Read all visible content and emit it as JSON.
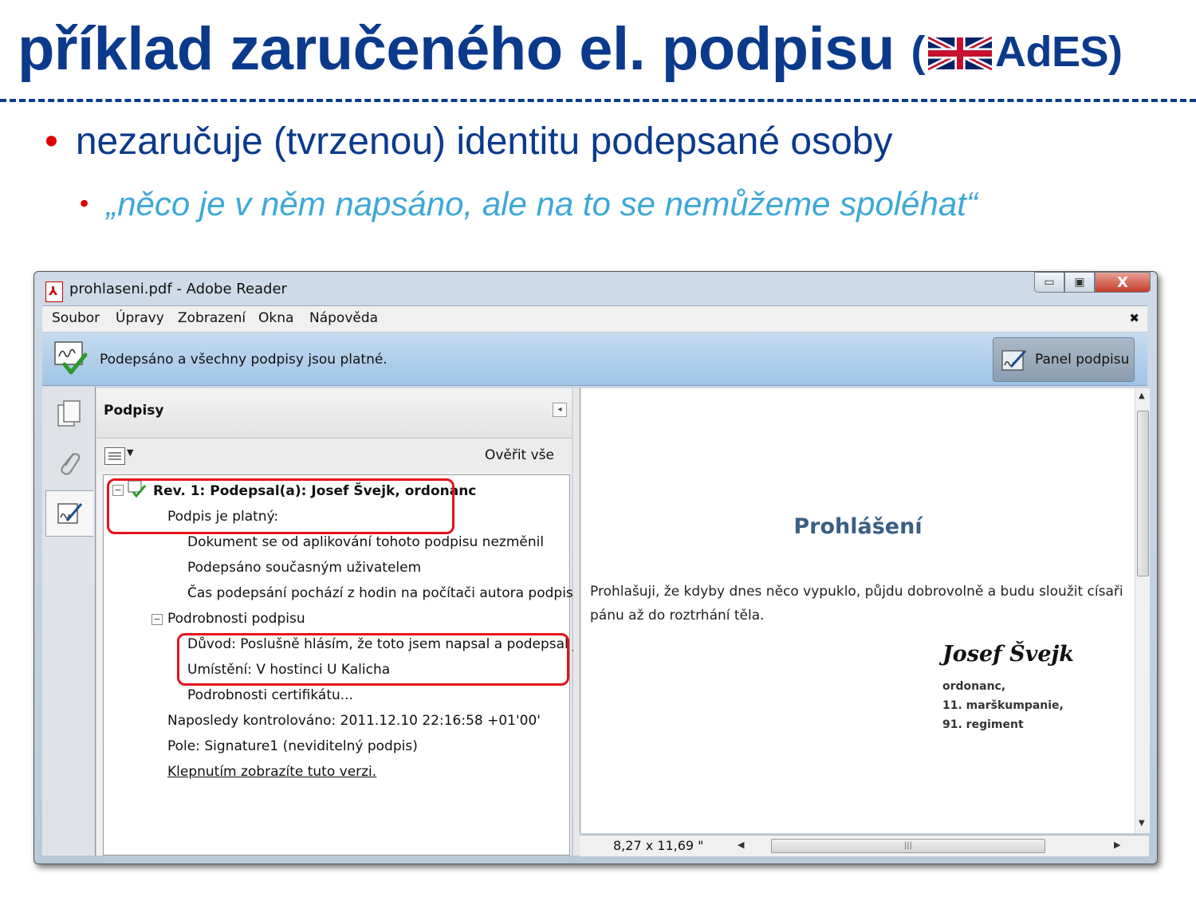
{
  "slide": {
    "title": "příklad zaručeného el. podpisu",
    "title_suffix_open": "(",
    "title_suffix_text": "AdES)",
    "bullet1": "nezaručuje (tvrzenou) identitu podepsané osoby",
    "bullet2": "„něco je v něm napsáno, ale na to se nemůžeme spoléhat“",
    "bullet_glyph": "•",
    "flag_icon": "uk-flag-icon"
  },
  "window": {
    "title": "prohlaseni.pdf - Adobe Reader",
    "controls": {
      "minimize": "▭",
      "maximize": "▣",
      "close": "X"
    }
  },
  "menu": {
    "items": [
      "Soubor",
      "Úpravy",
      "Zobrazení",
      "Okna",
      "Nápověda"
    ],
    "close_glyph": "✖"
  },
  "signature_bar": {
    "status": "Podepsáno a všechny podpisy jsou platné.",
    "panel_button": "Panel podpisu"
  },
  "signatures_panel": {
    "title": "Podpisy",
    "verify_all": "Ověřit vše",
    "tree": {
      "revision": "Rev. 1: Podepsal(a): Josef Švejk, ordonanc",
      "valid": "Podpis je platný:",
      "checks": [
        "Dokument se od aplikování tohoto podpisu nezměnil",
        "Podepsáno současným uživatelem",
        "Čas podepsání pochází z hodin na počítači autora podpisu."
      ],
      "details": "Podrobnosti podpisu",
      "reason": "Důvod: Poslušně hlásím, že toto jsem napsal a podepsal já!",
      "location": "Umístění: V hostinci U Kalicha",
      "cert_details": "Podrobnosti certifikátu...",
      "last_checked": "Naposledy kontrolováno: 2011.12.10 22:16:58 +01'00'",
      "field": "Pole: Signature1 (neviditelný podpis)",
      "view_version": "Klepnutím zobrazíte tuto verzi."
    }
  },
  "document": {
    "heading": "Prohlášení",
    "body": "Prohlašuji, že kdyby dnes něco vypuklo, půjdu dobrovolně a budu sloužit císaři pánu až do roztrhání těla.",
    "signature": "Josef Švejk",
    "meta": [
      "ordonanc,",
      "11. maršku­mpanie,",
      "91. regiment"
    ],
    "page_size": "8,27 x 11,69 \""
  },
  "colors": {
    "title_blue": "#0a3a8c",
    "bullet_red": "#e00000",
    "quote_cyan": "#3da8d8",
    "highlight_red": "#e5121b"
  }
}
